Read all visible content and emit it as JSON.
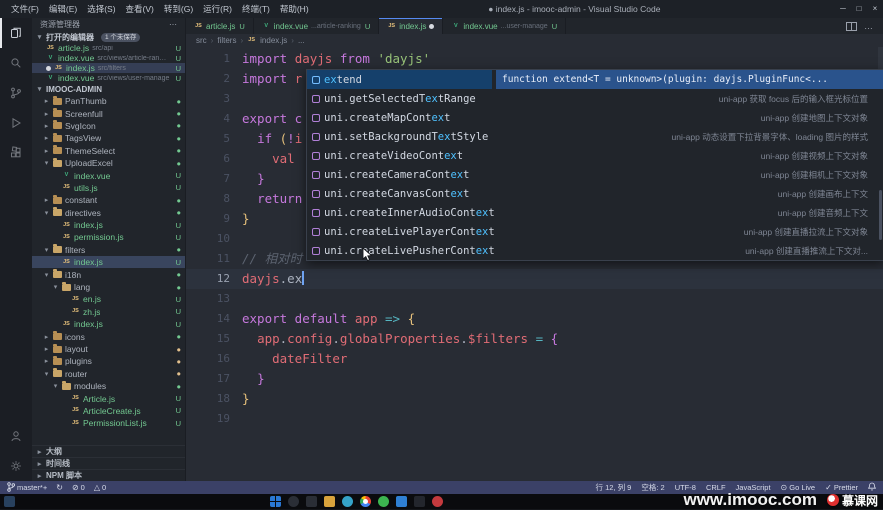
{
  "colors": {
    "accent_blue": "#4fc1ff",
    "git_untracked_green": "#73c991",
    "git_modified_orange": "#e2c08d",
    "editor_bg": "#282c34",
    "sidebar_bg": "#21252b",
    "statusbar_bg": "#3b4167",
    "suggest_doc_bg": "#2a538c"
  },
  "title_bar": {
    "menus": [
      "文件(F)",
      "编辑(E)",
      "选择(S)",
      "查看(V)",
      "转到(G)",
      "运行(R)",
      "终端(T)",
      "帮助(H)"
    ],
    "title": "● index.js - imooc-admin - Visual Studio Code",
    "window_controls": [
      "─",
      "□",
      "×"
    ]
  },
  "sidebar": {
    "title": "资源管理器",
    "open_editors": {
      "label": "打开的编辑器",
      "badge": "1 个未保存",
      "items": [
        {
          "file": "article.js",
          "path": "src/api",
          "type": "js",
          "badge": "U"
        },
        {
          "file": "index.vue",
          "path": "src/views/article-ranking",
          "type": "vue",
          "badge": "U"
        },
        {
          "file": "index.js",
          "path": "src/filters",
          "type": "js",
          "badge": "U",
          "active": true,
          "dirty": true
        },
        {
          "file": "index.vue",
          "path": "src/views/user-manage",
          "type": "vue",
          "badge": "U"
        }
      ]
    },
    "project": "IMOOC-ADMIN",
    "tree": [
      {
        "label": "PanThumb",
        "kind": "folder",
        "open": false,
        "depth": 1,
        "badge": "●",
        "badge_color": "green"
      },
      {
        "label": "Screenfull",
        "kind": "folder",
        "open": false,
        "depth": 1,
        "badge": "●",
        "badge_color": "green"
      },
      {
        "label": "SvgIcon",
        "kind": "folder",
        "open": false,
        "depth": 1,
        "badge": "●",
        "badge_color": "green"
      },
      {
        "label": "TagsView",
        "kind": "folder",
        "open": false,
        "depth": 1,
        "badge": "●",
        "badge_color": "green"
      },
      {
        "label": "ThemeSelect",
        "kind": "folder",
        "open": false,
        "depth": 1,
        "badge": "●",
        "badge_color": "green"
      },
      {
        "label": "UploadExcel",
        "kind": "folder",
        "open": true,
        "depth": 1,
        "badge": "●",
        "badge_color": "green"
      },
      {
        "label": "index.vue",
        "kind": "vue",
        "depth": 2,
        "badge": "U",
        "badge_color": "green"
      },
      {
        "label": "utils.js",
        "kind": "js",
        "depth": 2,
        "badge": "U",
        "badge_color": "green"
      },
      {
        "label": "constant",
        "kind": "folder",
        "open": false,
        "depth": 1,
        "badge": "●",
        "badge_color": "green"
      },
      {
        "label": "directives",
        "kind": "folder",
        "open": true,
        "depth": 1,
        "badge": "●",
        "badge_color": "green"
      },
      {
        "label": "index.js",
        "kind": "js",
        "depth": 2,
        "badge": "U",
        "badge_color": "green"
      },
      {
        "label": "permission.js",
        "kind": "js",
        "depth": 2,
        "badge": "U",
        "badge_color": "green"
      },
      {
        "label": "filters",
        "kind": "folder",
        "open": true,
        "depth": 1,
        "badge": "●",
        "badge_color": "green"
      },
      {
        "label": "index.js",
        "kind": "js",
        "depth": 2,
        "badge": "U",
        "badge_color": "green",
        "selected": true
      },
      {
        "label": "i18n",
        "kind": "folder",
        "open": true,
        "depth": 1,
        "badge": "●",
        "badge_color": "green"
      },
      {
        "label": "lang",
        "kind": "folder",
        "open": true,
        "depth": 2,
        "badge": "●",
        "badge_color": "green"
      },
      {
        "label": "en.js",
        "kind": "js",
        "depth": 3,
        "badge": "U",
        "badge_color": "green"
      },
      {
        "label": "zh.js",
        "kind": "js",
        "depth": 3,
        "badge": "U",
        "badge_color": "green"
      },
      {
        "label": "index.js",
        "kind": "js",
        "depth": 2,
        "badge": "U",
        "badge_color": "green"
      },
      {
        "label": "icons",
        "kind": "folder",
        "open": false,
        "depth": 1,
        "badge": "●",
        "badge_color": "green"
      },
      {
        "label": "layout",
        "kind": "folder",
        "open": false,
        "depth": 1,
        "badge": "●",
        "badge_color": "orange"
      },
      {
        "label": "plugins",
        "kind": "folder",
        "open": false,
        "depth": 1,
        "badge": "●",
        "badge_color": "orange"
      },
      {
        "label": "router",
        "kind": "folder",
        "open": true,
        "depth": 1,
        "badge": "●",
        "badge_color": "orange"
      },
      {
        "label": "modules",
        "kind": "folder",
        "open": true,
        "depth": 2,
        "badge": "●",
        "badge_color": "green"
      },
      {
        "label": "Article.js",
        "kind": "js",
        "depth": 3,
        "badge": "U",
        "badge_color": "green"
      },
      {
        "label": "ArticleCreate.js",
        "kind": "js",
        "depth": 3,
        "badge": "U",
        "badge_color": "green"
      },
      {
        "label": "PermissionList.js",
        "kind": "js",
        "depth": 3,
        "badge": "U",
        "badge_color": "green"
      }
    ],
    "bottom_sections": [
      {
        "label": "大纲",
        "name": "outline-section"
      },
      {
        "label": "时间线",
        "name": "timeline-section"
      },
      {
        "label": "NPM 脚本",
        "name": "npm-scripts-section"
      }
    ]
  },
  "editor": {
    "tabs": [
      {
        "file": "article.js",
        "type": "js",
        "badge": "U",
        "active": false
      },
      {
        "file": "index.vue",
        "desc": "...article-ranking",
        "type": "vue",
        "badge": "U",
        "active": false
      },
      {
        "file": "index.js",
        "type": "js",
        "dirty": true,
        "active": true
      },
      {
        "file": "index.vue",
        "desc": "...user-manage",
        "type": "vue",
        "badge": "U",
        "active": false
      }
    ],
    "breadcrumb": [
      {
        "label": "src"
      },
      {
        "label": "filters"
      },
      {
        "label": "index.js",
        "icon": "js"
      },
      {
        "label": "..."
      }
    ],
    "cursor": {
      "line": 12,
      "col": 9
    },
    "lines": [
      {
        "n": 1,
        "t": [
          [
            "kw",
            "import "
          ],
          [
            "vr",
            "dayjs "
          ],
          [
            "kw",
            "from "
          ],
          [
            "st",
            "'dayjs'"
          ]
        ]
      },
      {
        "n": 2,
        "t": [
          [
            "kw",
            "import "
          ],
          [
            "vr",
            "r"
          ]
        ]
      },
      {
        "n": 3,
        "t": []
      },
      {
        "n": 4,
        "t": [
          [
            "kw",
            "export c"
          ]
        ]
      },
      {
        "n": 5,
        "t": [
          [
            "pl",
            "  "
          ],
          [
            "kw",
            "if "
          ],
          [
            "gd",
            "("
          ],
          [
            "kw",
            "!"
          ],
          [
            "vr",
            "i"
          ]
        ]
      },
      {
        "n": 6,
        "t": [
          [
            "pl",
            "    "
          ],
          [
            "vr",
            "val"
          ]
        ]
      },
      {
        "n": 7,
        "t": [
          [
            "pl",
            "  "
          ],
          [
            "kw",
            "}"
          ]
        ]
      },
      {
        "n": 8,
        "t": [
          [
            "pl",
            "  "
          ],
          [
            "kw",
            "return"
          ]
        ]
      },
      {
        "n": 9,
        "t": [
          [
            "gd",
            "}"
          ]
        ]
      },
      {
        "n": 10,
        "t": []
      },
      {
        "n": 11,
        "t": [
          [
            "cm",
            "// 相对时"
          ]
        ]
      },
      {
        "n": 12,
        "t": [
          [
            "vr",
            "dayjs"
          ],
          [
            "pl",
            "."
          ],
          [
            "pl",
            "ex"
          ]
        ]
      },
      {
        "n": 13,
        "t": []
      },
      {
        "n": 14,
        "t": [
          [
            "kw",
            "export default "
          ],
          [
            "vr",
            "app"
          ],
          [
            "pl",
            " "
          ],
          [
            "cy",
            "=>"
          ],
          [
            "pl",
            " "
          ],
          [
            "gd",
            "{"
          ]
        ]
      },
      {
        "n": 15,
        "t": [
          [
            "pl",
            "  "
          ],
          [
            "vr",
            "app"
          ],
          [
            "pl",
            "."
          ],
          [
            "vr",
            "config"
          ],
          [
            "pl",
            "."
          ],
          [
            "vr",
            "globalProperties"
          ],
          [
            "pl",
            "."
          ],
          [
            "vr",
            "$filters"
          ],
          [
            "pl",
            " "
          ],
          [
            "cy",
            "="
          ],
          [
            "pl",
            " "
          ],
          [
            "kw",
            "{"
          ]
        ]
      },
      {
        "n": 16,
        "t": [
          [
            "pl",
            "    "
          ],
          [
            "vr",
            "dateFilter"
          ]
        ]
      },
      {
        "n": 17,
        "t": [
          [
            "pl",
            "  "
          ],
          [
            "kw",
            "}"
          ]
        ]
      },
      {
        "n": 18,
        "t": [
          [
            "gd",
            "}"
          ]
        ]
      },
      {
        "n": 19,
        "t": []
      }
    ]
  },
  "suggest": {
    "doc": "function extend<T = unknown>(plugin: dayjs.PluginFunc<...",
    "items": [
      {
        "icon": "cyan",
        "pre": "",
        "match": "ex",
        "post": "tend",
        "detail": "",
        "selected": true
      },
      {
        "icon": "purple",
        "pre": "uni.getSelectedT",
        "match": "ex",
        "post": "tRange",
        "detail": "uni-app 获取 focus 后的输入框光标位置"
      },
      {
        "icon": "purple",
        "pre": "uni.createMapCont",
        "match": "ex",
        "post": "t",
        "detail": "uni-app 创建地图上下文对象"
      },
      {
        "icon": "purple",
        "pre": "uni.setBackgroundT",
        "match": "ex",
        "post": "tStyle",
        "detail": "uni-app 动态设置下拉背景字体、loading 图片的样式"
      },
      {
        "icon": "purple",
        "pre": "uni.createVideoCont",
        "match": "ex",
        "post": "t",
        "detail": "uni-app 创建视频上下文对象"
      },
      {
        "icon": "purple",
        "pre": "uni.createCameraCont",
        "match": "ex",
        "post": "t",
        "detail": "uni-app 创建相机上下文对象"
      },
      {
        "icon": "purple",
        "pre": "uni.createCanvasCont",
        "match": "ex",
        "post": "t",
        "detail": "uni-app 创建画布上下文"
      },
      {
        "icon": "purple",
        "pre": "uni.createInnerAudioCont",
        "match": "ex",
        "post": "t",
        "detail": "uni-app 创建音频上下文"
      },
      {
        "icon": "purple",
        "pre": "uni.createLivePlayerCont",
        "match": "ex",
        "post": "t",
        "detail": "uni-app 创建直播拉流上下文对象"
      },
      {
        "icon": "purple",
        "pre": "uni.createLivePusherCont",
        "match": "ex",
        "post": "t",
        "detail": "uni-app 创建直播推流上下文对..."
      }
    ]
  },
  "status_bar": {
    "left": [
      {
        "name": "git-branch",
        "icon": "branch",
        "text": "master*+"
      },
      {
        "name": "sync-changes",
        "icon": "sync",
        "text": ""
      },
      {
        "name": "errors",
        "icon": "error",
        "text": "0"
      },
      {
        "name": "warnings",
        "icon": "warning",
        "text": "0"
      }
    ],
    "right": [
      {
        "name": "cursor-position",
        "text": "行 12, 列 9"
      },
      {
        "name": "indentation",
        "text": "空格: 2"
      },
      {
        "name": "encoding",
        "text": "UTF-8"
      },
      {
        "name": "eol",
        "text": "CRLF"
      },
      {
        "name": "language-mode",
        "text": "JavaScript"
      },
      {
        "name": "go-live",
        "icon": "golive",
        "text": "Go Live"
      },
      {
        "name": "prettier",
        "icon": "check",
        "text": "Prettier"
      },
      {
        "name": "notifications",
        "icon": "bell",
        "text": ""
      }
    ]
  },
  "taskbar": {
    "icons": [
      {
        "name": "start",
        "color": "#2a78d4",
        "shape": "square"
      },
      {
        "name": "search",
        "color": "#2a2e36",
        "shape": "circle"
      },
      {
        "name": "task-view",
        "color": "#2a2e36",
        "shape": "square"
      },
      {
        "name": "file-explorer",
        "color": "#d9a33c",
        "shape": "square"
      },
      {
        "name": "edge",
        "color": "#35a3c8",
        "shape": "circle"
      },
      {
        "name": "chrome",
        "color": "#e04a3f",
        "shape": "circle"
      },
      {
        "name": "wechat",
        "color": "#3cb550",
        "shape": "circle"
      },
      {
        "name": "vscode",
        "color": "#2f80d4",
        "shape": "square"
      },
      {
        "name": "terminal",
        "color": "#23262d",
        "shape": "square"
      },
      {
        "name": "music",
        "color": "#c43a3e",
        "shape": "circle"
      }
    ]
  },
  "watermark": {
    "url": "www.imooc.com",
    "brand": "慕课网"
  }
}
